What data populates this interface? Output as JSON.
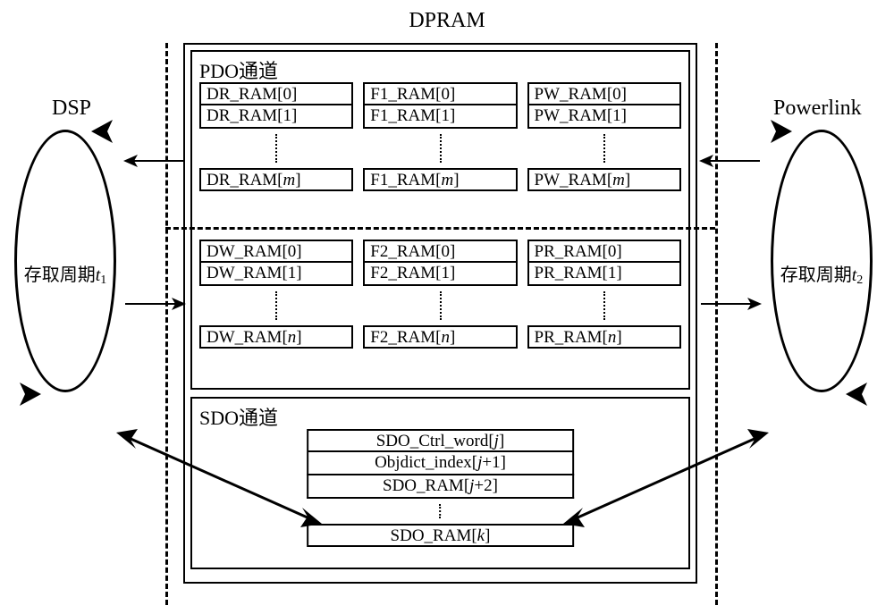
{
  "title": "DPRAM",
  "left_actor": {
    "name": "DSP",
    "period_label_prefix": "存取周期",
    "period_symbol": "t",
    "period_sub": "1"
  },
  "right_actor": {
    "name": "Powerlink",
    "period_label_prefix": "存取周期",
    "period_symbol": "t",
    "period_sub": "2"
  },
  "pdo": {
    "title": "PDO通道",
    "upper": {
      "col1": {
        "r0": "DR_RAM[0]",
        "r1": "DR_RAM[1]",
        "rm": "DR_RAM[m]"
      },
      "col2": {
        "r0": "F1_RAM[0]",
        "r1": "F1_RAM[1]",
        "rm": "F1_RAM[m]"
      },
      "col3": {
        "r0": "PW_RAM[0]",
        "r1": "PW_RAM[1]",
        "rm": "PW_RAM[m]"
      }
    },
    "lower": {
      "col1": {
        "r0": "DW_RAM[0]",
        "r1": "DW_RAM[1]",
        "rn": "DW_RAM[n]"
      },
      "col2": {
        "r0": "F2_RAM[0]",
        "r1": "F2_RAM[1]",
        "rn": "F2_RAM[n]"
      },
      "col3": {
        "r0": "PR_RAM[0]",
        "r1": "PR_RAM[1]",
        "rn": "PR_RAM[n]"
      }
    }
  },
  "sdo": {
    "title": "SDO通道",
    "rows": {
      "r0": "SDO_Ctrl_word[j]",
      "r1": "Objdict_index[j+1]",
      "r2": "SDO_RAM[j+2]",
      "rk": "SDO_RAM[k]"
    }
  }
}
